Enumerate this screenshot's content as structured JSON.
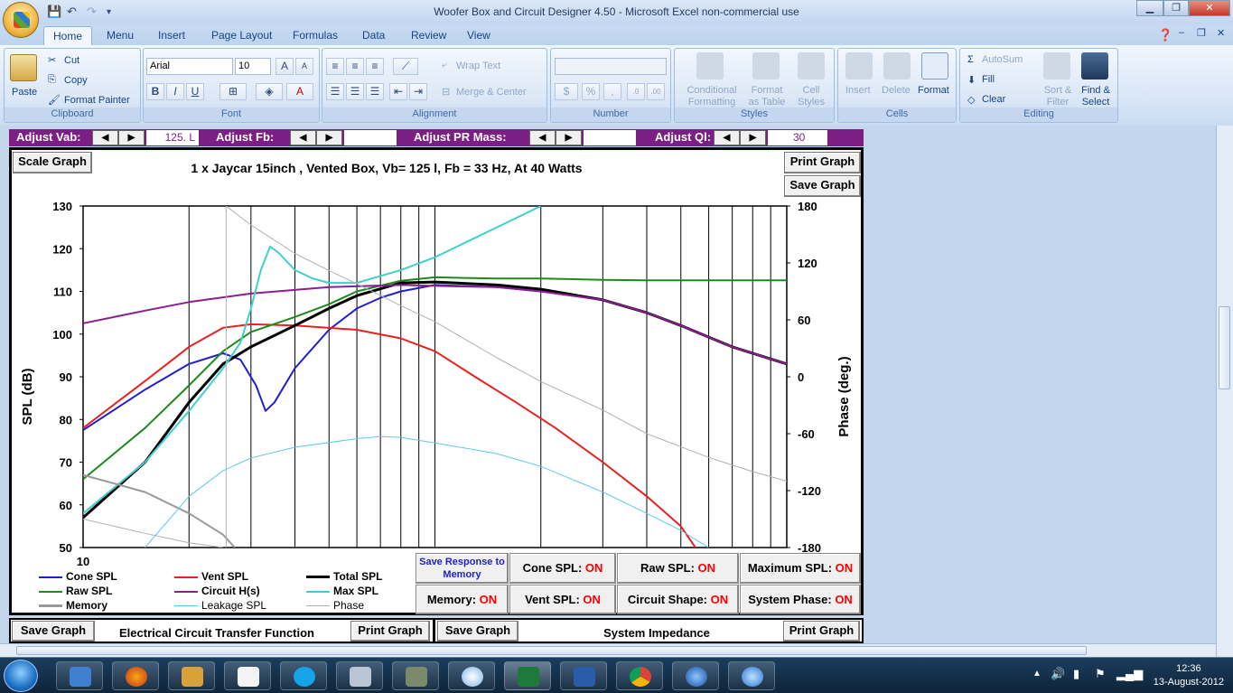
{
  "window": {
    "title": "Woofer Box and Circuit Designer 4.50  -  Microsoft Excel non-commercial use"
  },
  "ribbon_tabs": [
    "Home",
    "Menu",
    "Insert",
    "Page Layout",
    "Formulas",
    "Data",
    "Review",
    "View"
  ],
  "clipboard": {
    "paste": "Paste",
    "cut": "Cut",
    "copy": "Copy",
    "format_painter": "Format Painter",
    "label": "Clipboard"
  },
  "font": {
    "name": "Arial",
    "size": "10",
    "label": "Font",
    "bold": "B",
    "italic": "I",
    "underline": "U",
    "grow": "A",
    "color": "A"
  },
  "alignment": {
    "wrap": "Wrap Text",
    "merge": "Merge & Center",
    "label": "Alignment"
  },
  "number": {
    "currency": "$",
    "percent": "%",
    "comma": ",",
    "label": "Number"
  },
  "styles": {
    "conditional": "Conditional Formatting",
    "as_table": "Format as Table",
    "cell_styles": "Cell Styles",
    "label": "Styles"
  },
  "cells": {
    "insert": "Insert",
    "delete": "Delete",
    "format": "Format",
    "label": "Cells"
  },
  "editing": {
    "autosum": "AutoSum",
    "fill": "Fill",
    "clear": "Clear",
    "sort": "Sort & Filter",
    "find": "Find & Select",
    "label": "Editing"
  },
  "controls": {
    "vab_label": "Adjust Vab:",
    "vab_value": "125. L",
    "fb_label": "Adjust Fb:",
    "fb_value": "",
    "pr_label": "Adjust PR Mass:",
    "pr_value": "",
    "ql_label": "Adjust Ql:",
    "ql_value": "30",
    "left": "◀",
    "right": "▶"
  },
  "buttons": {
    "scale": "Scale Graph",
    "print": "Print Graph",
    "save": "Save Graph",
    "save_response": "Save Response to Memory",
    "bottom_left_save": "Save Graph",
    "bottom_left_title": "Electrical Circuit Transfer Function",
    "bottom_left_print": "Print Graph",
    "bottom_right_save": "Save Graph",
    "bottom_right_title": "System Impedance",
    "bottom_right_print": "Print Graph"
  },
  "toggles": [
    {
      "label": "Cone SPL:",
      "state": "ON"
    },
    {
      "label": "Raw SPL:",
      "state": "ON"
    },
    {
      "label": "Maximum SPL:",
      "state": "ON"
    },
    {
      "label": "Memory:",
      "state": "ON"
    },
    {
      "label": "Vent SPL:",
      "state": "ON"
    },
    {
      "label": "Circuit Shape:",
      "state": "ON"
    },
    {
      "label": "System Phase:",
      "state": "ON"
    }
  ],
  "legend": [
    {
      "name": "Cone SPL",
      "color": "#1f1fd1"
    },
    {
      "name": "Vent SPL",
      "color": "#e8211f"
    },
    {
      "name": "Total SPL",
      "color": "#000000"
    },
    {
      "name": "Raw SPL",
      "color": "#1d8a1d"
    },
    {
      "name": "Circuit H(s)",
      "color": "#8a1f8f"
    },
    {
      "name": "Max SPL",
      "color": "#3fcfcf"
    },
    {
      "name": "Memory",
      "color": "#999999"
    },
    {
      "name": "Leakage SPL",
      "color": "#5cc8e8"
    },
    {
      "name": "Phase",
      "color": "#b0b0b0"
    }
  ],
  "chart_data": {
    "type": "line",
    "title": "1 x Jaycar 15inch ,  Vented Box, Vb= 125 l,  Fb = 33 Hz,  At 40 Watts",
    "ylabel": "SPL (dB)",
    "y2label": "Phase (deg.)",
    "xlabel": "",
    "x_scale": "log",
    "xlim": [
      10,
      1000
    ],
    "ylim": [
      50,
      130
    ],
    "y2lim": [
      -180,
      180
    ],
    "x_tick_label": "10",
    "y_ticks": [
      50,
      60,
      70,
      80,
      90,
      100,
      110,
      120,
      130
    ],
    "y2_ticks": [
      -180,
      -120,
      -60,
      0,
      60,
      120,
      180
    ],
    "grid": "vertical",
    "series": [
      {
        "name": "Cone SPL",
        "color": "#1f1fd1",
        "points": [
          [
            10,
            77.5
          ],
          [
            15,
            87
          ],
          [
            20,
            93
          ],
          [
            25,
            95.5
          ],
          [
            28,
            94
          ],
          [
            31,
            88
          ],
          [
            33,
            82
          ],
          [
            35,
            84
          ],
          [
            40,
            92
          ],
          [
            50,
            101
          ],
          [
            60,
            106
          ],
          [
            70,
            108.5
          ],
          [
            80,
            110
          ],
          [
            100,
            111.5
          ],
          [
            150,
            111
          ],
          [
            200,
            110
          ],
          [
            300,
            108
          ],
          [
            400,
            105
          ],
          [
            500,
            102
          ],
          [
            700,
            97
          ],
          [
            1000,
            93
          ]
        ]
      },
      {
        "name": "Vent SPL",
        "color": "#e8211f",
        "points": [
          [
            10,
            78
          ],
          [
            15,
            89
          ],
          [
            20,
            97
          ],
          [
            25,
            101.5
          ],
          [
            30,
            102.3
          ],
          [
            40,
            102
          ],
          [
            60,
            101
          ],
          [
            80,
            99
          ],
          [
            100,
            96
          ],
          [
            130,
            90
          ],
          [
            170,
            84
          ],
          [
            220,
            78
          ],
          [
            300,
            70
          ],
          [
            400,
            62
          ],
          [
            500,
            55
          ],
          [
            550,
            50
          ]
        ]
      },
      {
        "name": "Total SPL",
        "color": "#000000",
        "points": [
          [
            10,
            57
          ],
          [
            15,
            70
          ],
          [
            20,
            84
          ],
          [
            25,
            93
          ],
          [
            30,
            97
          ],
          [
            40,
            102
          ],
          [
            50,
            106
          ],
          [
            60,
            109
          ],
          [
            80,
            112
          ],
          [
            100,
            112.2
          ],
          [
            150,
            111.5
          ],
          [
            200,
            110.5
          ],
          [
            300,
            108
          ],
          [
            400,
            105
          ],
          [
            500,
            102
          ],
          [
            700,
            97
          ],
          [
            1000,
            93
          ]
        ]
      },
      {
        "name": "Raw SPL",
        "color": "#1d8a1d",
        "points": [
          [
            10,
            66
          ],
          [
            15,
            78
          ],
          [
            20,
            88
          ],
          [
            25,
            96
          ],
          [
            30,
            100.5
          ],
          [
            40,
            104
          ],
          [
            50,
            107
          ],
          [
            60,
            110
          ],
          [
            80,
            112.5
          ],
          [
            100,
            113.3
          ],
          [
            150,
            113
          ],
          [
            200,
            113
          ],
          [
            300,
            112.7
          ],
          [
            400,
            112.6
          ],
          [
            1000,
            112.6
          ]
        ]
      },
      {
        "name": "Circuit H(s)",
        "color": "#8a1f8f",
        "points": [
          [
            10,
            102.5
          ],
          [
            15,
            105.5
          ],
          [
            20,
            107.5
          ],
          [
            30,
            109.5
          ],
          [
            50,
            111
          ],
          [
            80,
            111.5
          ],
          [
            100,
            111.3
          ],
          [
            150,
            111
          ],
          [
            200,
            110
          ],
          [
            300,
            108
          ],
          [
            400,
            105
          ],
          [
            500,
            102
          ],
          [
            700,
            97
          ],
          [
            1000,
            93
          ]
        ]
      },
      {
        "name": "Max SPL",
        "color": "#3fcfcf",
        "points": [
          [
            10,
            58
          ],
          [
            15,
            70
          ],
          [
            20,
            82
          ],
          [
            25,
            92
          ],
          [
            28,
            98
          ],
          [
            30,
            106
          ],
          [
            32,
            115
          ],
          [
            34,
            120.5
          ],
          [
            36,
            119
          ],
          [
            40,
            115
          ],
          [
            45,
            113
          ],
          [
            50,
            112
          ],
          [
            60,
            112
          ],
          [
            80,
            115
          ],
          [
            100,
            118
          ],
          [
            150,
            125
          ],
          [
            200,
            130
          ]
        ]
      },
      {
        "name": "Memory",
        "color": "#999999",
        "points": [
          [
            10,
            67
          ],
          [
            15,
            63
          ],
          [
            20,
            58
          ],
          [
            25,
            53
          ],
          [
            27,
            50
          ]
        ]
      },
      {
        "name": "Leakage SPL",
        "color": "#5cc8e8",
        "points": [
          [
            15,
            50
          ],
          [
            20,
            62
          ],
          [
            25,
            68
          ],
          [
            30,
            71
          ],
          [
            40,
            73.5
          ],
          [
            60,
            75.5
          ],
          [
            70,
            76
          ],
          [
            80,
            75.8
          ],
          [
            100,
            74.5
          ],
          [
            150,
            72
          ],
          [
            200,
            69
          ],
          [
            300,
            63
          ],
          [
            400,
            58
          ],
          [
            500,
            54
          ],
          [
            600,
            50
          ]
        ]
      },
      {
        "name": "Phase",
        "color": "#b0b0b0",
        "points": [
          [
            10,
            -150
          ],
          [
            15,
            -165
          ],
          [
            20,
            -175
          ],
          [
            25,
            -180
          ],
          [
            25.5,
            180
          ],
          [
            30,
            160
          ],
          [
            40,
            130
          ],
          [
            50,
            112
          ],
          [
            60,
            98
          ],
          [
            80,
            75
          ],
          [
            100,
            58
          ],
          [
            150,
            20
          ],
          [
            200,
            -5
          ],
          [
            300,
            -35
          ],
          [
            400,
            -60
          ],
          [
            600,
            -85
          ],
          [
            800,
            -100
          ],
          [
            1000,
            -110
          ]
        ]
      }
    ]
  }
}
